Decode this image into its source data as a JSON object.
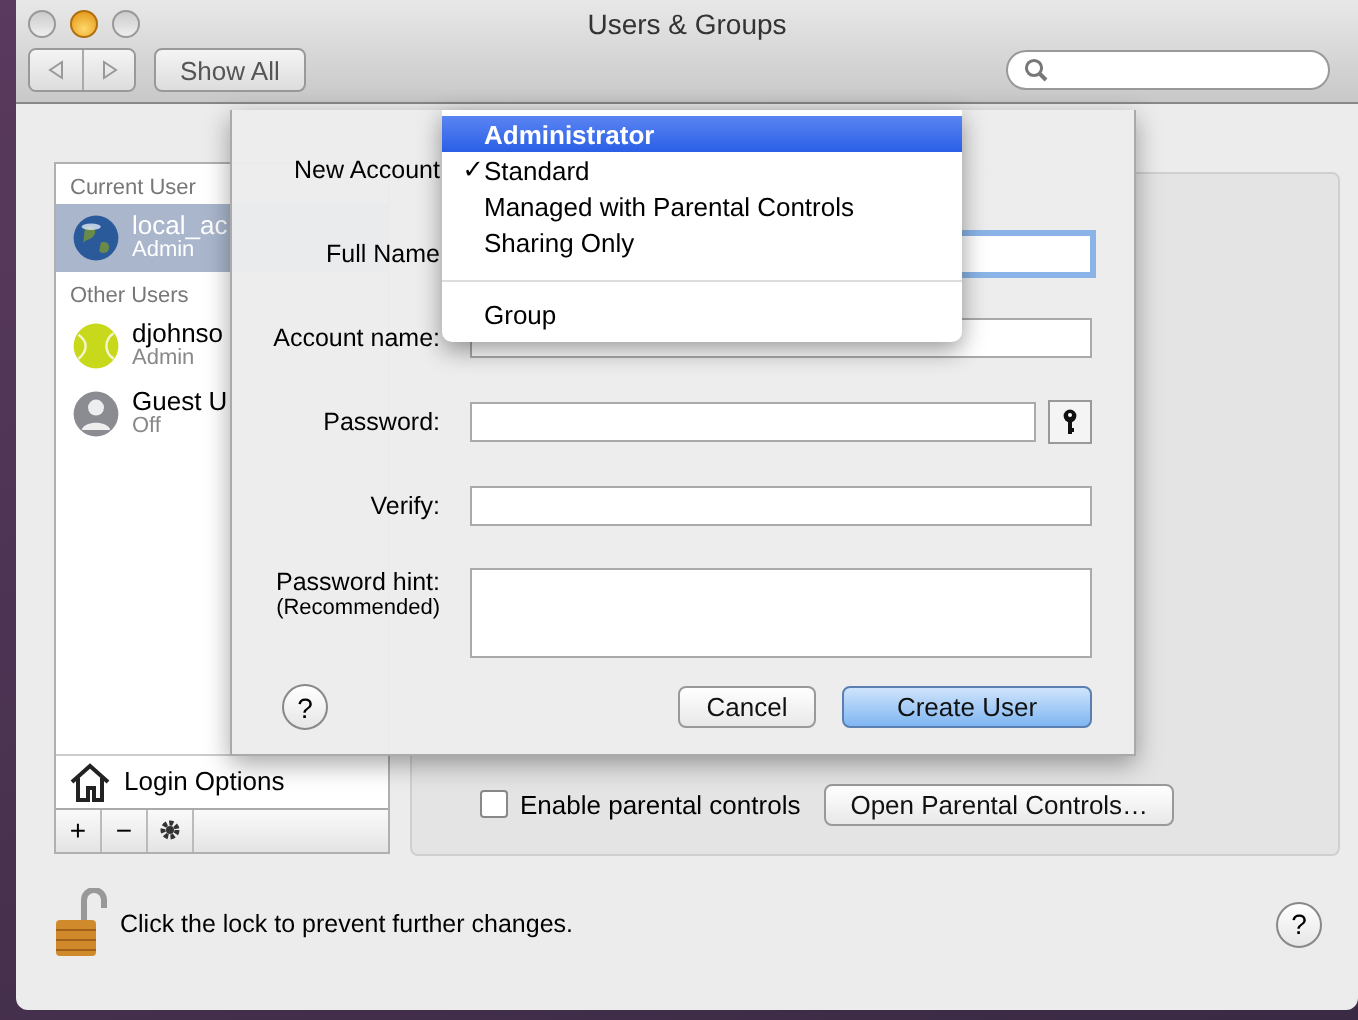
{
  "window": {
    "title": "Users & Groups"
  },
  "toolbar": {
    "show_all": "Show All"
  },
  "sidebar": {
    "sections": [
      {
        "header": "Current User",
        "users": [
          {
            "name": "local_ac",
            "role": "Admin",
            "selected": true
          }
        ]
      },
      {
        "header": "Other Users",
        "users": [
          {
            "name": "djohnso",
            "role": "Admin",
            "selected": false
          },
          {
            "name": "Guest U",
            "role": "Off",
            "selected": false
          }
        ]
      }
    ],
    "login_options": "Login Options",
    "buttons": [
      "+",
      "−"
    ]
  },
  "panel": {
    "parental_checkbox": {
      "label": "Enable parental controls",
      "checked": false
    },
    "open_parental_button": "Open Parental Controls…"
  },
  "sheet": {
    "new_account_label": "New Account",
    "fields": [
      {
        "label": "Full Name",
        "kind": "text",
        "focused": true
      },
      {
        "label": "Account name:",
        "kind": "text",
        "focused": false
      },
      {
        "label": "Password:",
        "kind": "password",
        "focused": false
      },
      {
        "label": "Verify:",
        "kind": "text",
        "focused": false
      },
      {
        "label": "Password hint:",
        "sublabel": "(Recommended)",
        "kind": "area",
        "focused": false
      }
    ],
    "help": "?",
    "cancel": "Cancel",
    "create": "Create User"
  },
  "menu": {
    "items": [
      {
        "label": "Administrator",
        "selected": true,
        "checked": false
      },
      {
        "label": "Standard",
        "selected": false,
        "checked": true
      },
      {
        "label": "Managed with Parental Controls",
        "selected": false,
        "checked": false
      },
      {
        "label": "Sharing Only",
        "selected": false,
        "checked": false
      },
      {
        "kind": "separator"
      },
      {
        "label": "Group",
        "selected": false,
        "checked": false
      }
    ],
    "check_mark": "✓"
  },
  "footer": {
    "lock_text": "Click the lock to prevent further changes.",
    "help": "?"
  }
}
